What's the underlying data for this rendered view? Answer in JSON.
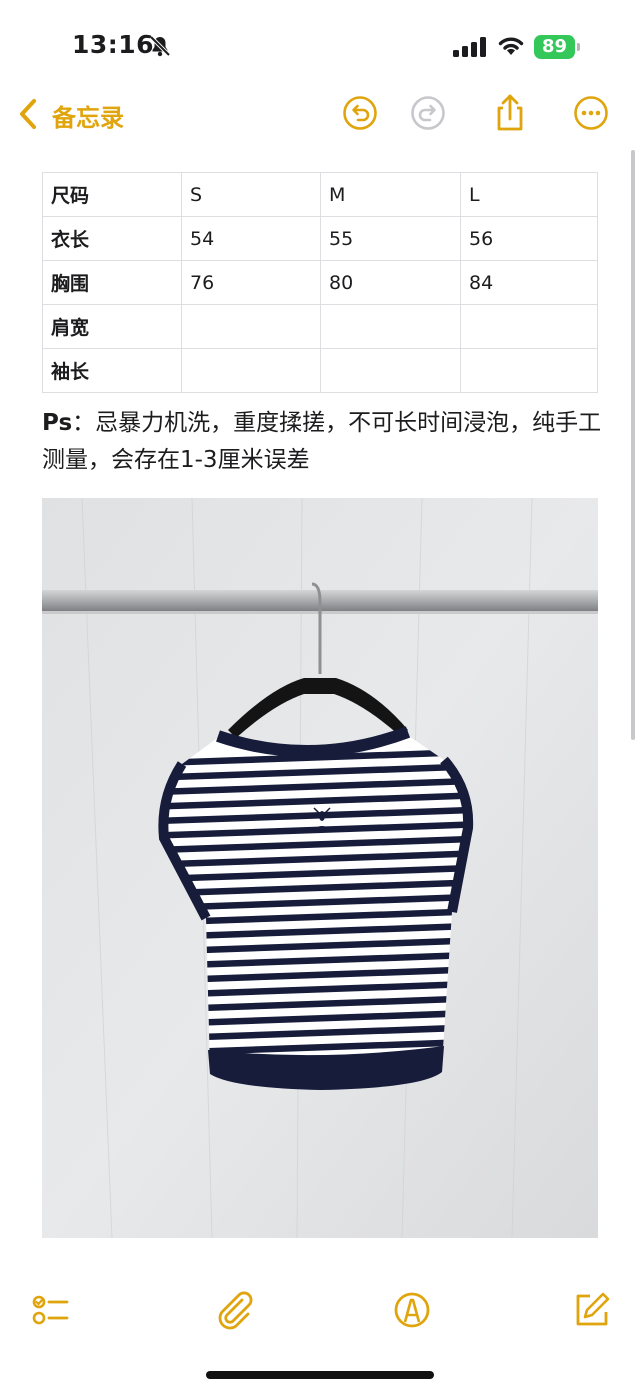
{
  "status_bar": {
    "time": "13:16",
    "battery": "89",
    "battery_color": "#34c759"
  },
  "nav": {
    "back_label": "备忘录",
    "accent_color": "#e0a40c",
    "icons": [
      "undo-icon",
      "redo-icon",
      "share-icon",
      "more-icon"
    ]
  },
  "table": {
    "rows": [
      [
        "尺码",
        "S",
        "M",
        "L"
      ],
      [
        "衣长",
        "54",
        "55",
        "56"
      ],
      [
        "胸围",
        "76",
        "80",
        "84"
      ],
      [
        "肩宽",
        "",
        "",
        ""
      ],
      [
        "袖长",
        "",
        "",
        ""
      ]
    ]
  },
  "note": {
    "prefix": "Ps",
    "text": "：忌暴力机洗，重度揉搓，不可长时间浸泡，纯手工测量，会存在1-3厘米误差"
  },
  "photo": {
    "subject": "striped-knit-top-on-hanger",
    "stripe_color": "#161c3a",
    "base_color": "#ffffff"
  },
  "toolbar": {
    "icons": [
      "checklist-icon",
      "attachment-icon",
      "markup-icon",
      "compose-icon"
    ]
  }
}
